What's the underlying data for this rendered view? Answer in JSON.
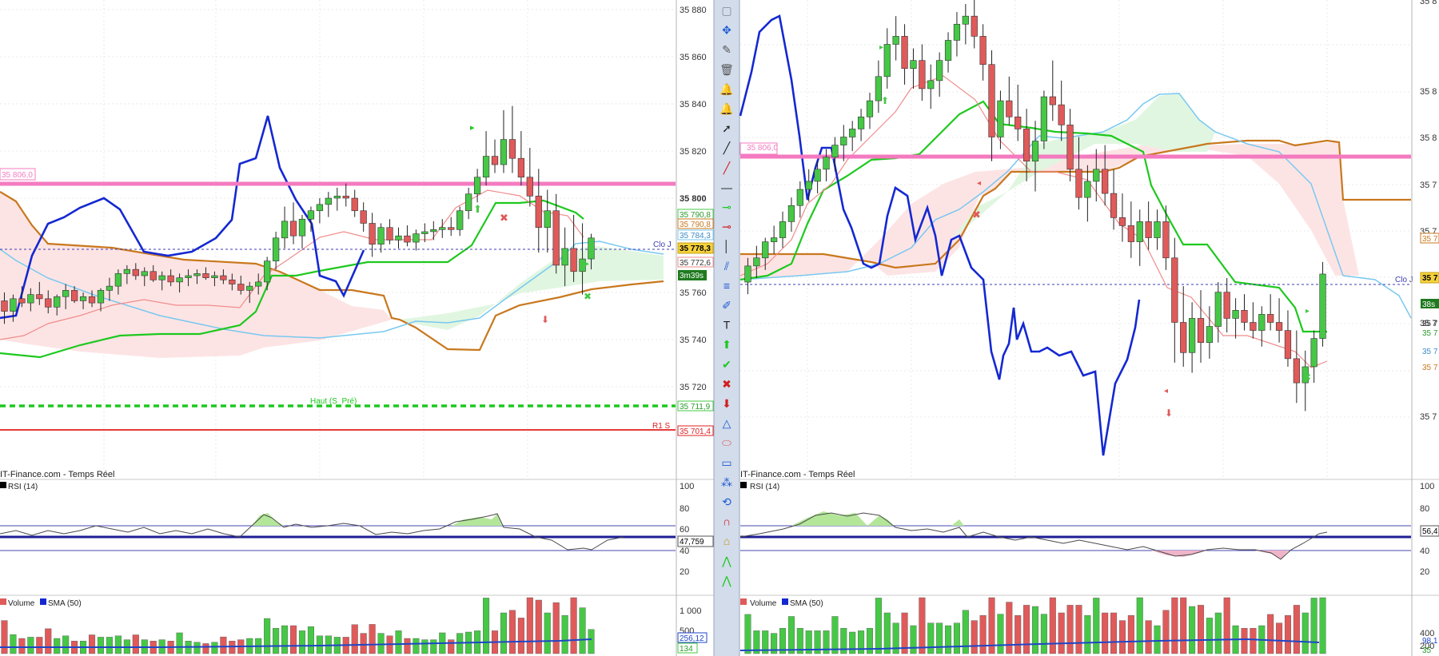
{
  "colors": {
    "bull": "#46c846",
    "bear": "#e05a5a",
    "blue": "#1428d2",
    "kijun": "#1ec81e",
    "tenkan": "#f08c8c",
    "ssb": "#c8781e",
    "ssa": "#78c8f0",
    "pink": "#f47ac0",
    "rsi_mid": "#1e1ea0",
    "sma": "#1e46c8"
  },
  "left": {
    "footer": "IT-Finance.com - Temps Réel",
    "rsi_label": "RSI (14)",
    "volume_label": "Volume",
    "sma_label": "SMA (50)",
    "price_ticks": [
      "35 880",
      "35 860",
      "35 840",
      "35 820",
      "35 800",
      "35 760",
      "35 740",
      "35 720"
    ],
    "badges": [
      "35 790,8",
      "35 790,8",
      "35 784,3",
      "35 778,3",
      "35 772,6",
      "3m39s",
      "35 711,9",
      "35 701,4"
    ],
    "pink_tag": "35 806,0",
    "clo_label": "Clo J",
    "haut_label": "Haut (S_Pré)",
    "r1_label": "R1 S",
    "rsi_ticks": [
      "100",
      "80",
      "60",
      "40",
      "20"
    ],
    "rsi_value": "47,759",
    "vol_ticks": [
      "1 000",
      "500"
    ],
    "vol_badges": [
      "256,12",
      "134"
    ]
  },
  "right": {
    "footer": "IT-Finance.com - Temps Réel",
    "rsi_label": "RSI (14)",
    "volume_label": "Volume",
    "sma_label": "SMA (50)",
    "price_ticks": [
      "35 8",
      "35 8",
      "35 8",
      "35 7",
      "35 7",
      "35 7",
      "35 7"
    ],
    "badges": [
      "35 7",
      "35 7",
      "38s",
      "35 7",
      "35 7",
      "35 7",
      "35 7"
    ],
    "pink_tag": "35 806,0",
    "clo_label": "Clo J",
    "rsi_ticks": [
      "100",
      "80",
      "60",
      "40",
      "20"
    ],
    "rsi_value": "56,4",
    "vol_ticks": [
      "400",
      "200"
    ],
    "vol_badges": [
      "98,1",
      "35"
    ]
  },
  "chart_data": [
    {
      "type": "candlestick",
      "panel": "left",
      "ylim": [
        35704,
        35884
      ],
      "ohlc": [
        [
          35745,
          35749,
          35734,
          35740
        ],
        [
          35740,
          35748,
          35735,
          35746
        ],
        [
          35746,
          35752,
          35742,
          35744
        ],
        [
          35744,
          35751,
          35740,
          35748
        ],
        [
          35748,
          35754,
          35743,
          35746
        ],
        [
          35746,
          35750,
          35739,
          35742
        ],
        [
          35742,
          35748,
          35738,
          35747
        ],
        [
          35747,
          35753,
          35741,
          35750
        ],
        [
          35750,
          35752,
          35744,
          35745
        ],
        [
          35745,
          35749,
          35741,
          35747
        ],
        [
          35747,
          35750,
          35742,
          35744
        ],
        [
          35744,
          35751,
          35740,
          35750
        ],
        [
          35750,
          35756,
          35745,
          35752
        ],
        [
          35752,
          35760,
          35748,
          35758
        ],
        [
          35758,
          35762,
          35753,
          35760
        ],
        [
          35760,
          35763,
          35755,
          35757
        ],
        [
          35757,
          35761,
          35752,
          35759
        ],
        [
          35759,
          35762,
          35754,
          35755
        ],
        [
          35755,
          35759,
          35750,
          35757
        ],
        [
          35757,
          35760,
          35752,
          35754
        ],
        [
          35754,
          35758,
          35749,
          35756
        ],
        [
          35756,
          35760,
          35752,
          35757
        ],
        [
          35757,
          35760,
          35753,
          35758
        ],
        [
          35758,
          35761,
          35755,
          35756
        ],
        [
          35756,
          35759,
          35752,
          35757
        ],
        [
          35757,
          35760,
          35753,
          35755
        ],
        [
          35755,
          35758,
          35750,
          35753
        ],
        [
          35753,
          35757,
          35748,
          35750
        ],
        [
          35750,
          35754,
          35744,
          35752
        ],
        [
          35752,
          35758,
          35748,
          35754
        ],
        [
          35754,
          35766,
          35750,
          35764
        ],
        [
          35764,
          35778,
          35760,
          35775
        ],
        [
          35775,
          35790,
          35770,
          35783
        ],
        [
          35783,
          35792,
          35772,
          35776
        ],
        [
          35776,
          35786,
          35770,
          35784
        ],
        [
          35784,
          35790,
          35778,
          35788
        ],
        [
          35788,
          35794,
          35782,
          35791
        ],
        [
          35791,
          35797,
          35785,
          35794
        ],
        [
          35794,
          35799,
          35788,
          35795
        ],
        [
          35795,
          35801,
          35790,
          35794
        ],
        [
          35794,
          35798,
          35785,
          35788
        ],
        [
          35788,
          35792,
          35778,
          35782
        ],
        [
          35782,
          35787,
          35766,
          35772
        ],
        [
          35772,
          35782,
          35768,
          35780
        ],
        [
          35780,
          35784,
          35772,
          35774
        ],
        [
          35774,
          35780,
          35770,
          35776
        ],
        [
          35776,
          35781,
          35771,
          35773
        ],
        [
          35773,
          35779,
          35769,
          35777
        ],
        [
          35777,
          35782,
          35773,
          35778
        ],
        [
          35778,
          35783,
          35774,
          35779
        ],
        [
          35779,
          35784,
          35775,
          35780
        ],
        [
          35780,
          35785,
          35776,
          35779
        ],
        [
          35779,
          35790,
          35776,
          35788
        ],
        [
          35788,
          35799,
          35784,
          35796
        ],
        [
          35796,
          35808,
          35792,
          35804
        ],
        [
          35804,
          35826,
          35800,
          35814
        ],
        [
          35814,
          35822,
          35806,
          35810
        ],
        [
          35810,
          35836,
          35806,
          35822
        ],
        [
          35822,
          35838,
          35806,
          35813
        ],
        [
          35813,
          35826,
          35800,
          35804
        ],
        [
          35804,
          35818,
          35790,
          35795
        ],
        [
          35795,
          35808,
          35768,
          35780
        ],
        [
          35780,
          35798,
          35768,
          35788
        ],
        [
          35788,
          35796,
          35758,
          35762
        ],
        [
          35762,
          35780,
          35752,
          35770
        ],
        [
          35770,
          35786,
          35754,
          35759
        ],
        [
          35759,
          35782,
          35748,
          35765
        ],
        [
          35765,
          35777,
          35760,
          35775
        ]
      ]
    },
    {
      "type": "candlestick",
      "panel": "right",
      "ylim": [
        35650,
        35880
      ],
      "ohlc": [
        [
          35740,
          35752,
          35734,
          35748
        ],
        [
          35748,
          35758,
          35742,
          35752
        ],
        [
          35752,
          35762,
          35746,
          35760
        ],
        [
          35760,
          35768,
          35754,
          35762
        ],
        [
          35762,
          35775,
          35757,
          35770
        ],
        [
          35770,
          35782,
          35765,
          35778
        ],
        [
          35778,
          35790,
          35772,
          35786
        ],
        [
          35786,
          35796,
          35780,
          35790
        ],
        [
          35790,
          35800,
          35784,
          35796
        ],
        [
          35796,
          35806,
          35790,
          35802
        ],
        [
          35802,
          35812,
          35795,
          35808
        ],
        [
          35808,
          35818,
          35800,
          35812
        ],
        [
          35812,
          35820,
          35805,
          35816
        ],
        [
          35816,
          35826,
          35810,
          35822
        ],
        [
          35822,
          35834,
          35816,
          35830
        ],
        [
          35830,
          35850,
          35824,
          35842
        ],
        [
          35842,
          35866,
          35836,
          35858
        ],
        [
          35858,
          35872,
          35850,
          35862
        ],
        [
          35862,
          35868,
          35838,
          35846
        ],
        [
          35846,
          35856,
          35836,
          35850
        ],
        [
          35850,
          35858,
          35830,
          35836
        ],
        [
          35836,
          35848,
          35826,
          35840
        ],
        [
          35840,
          35854,
          35832,
          35850
        ],
        [
          35850,
          35864,
          35844,
          35860
        ],
        [
          35860,
          35874,
          35852,
          35868
        ],
        [
          35868,
          35878,
          35858,
          35872
        ],
        [
          35872,
          35880,
          35856,
          35862
        ],
        [
          35862,
          35868,
          35840,
          35848
        ],
        [
          35848,
          35855,
          35800,
          35812
        ],
        [
          35812,
          35835,
          35806,
          35830
        ],
        [
          35830,
          35842,
          35818,
          35822
        ],
        [
          35822,
          35838,
          35810,
          35816
        ],
        [
          35816,
          35826,
          35790,
          35800
        ],
        [
          35800,
          35820,
          35785,
          35810
        ],
        [
          35810,
          35835,
          35806,
          35832
        ],
        [
          35832,
          35850,
          35820,
          35828
        ],
        [
          35828,
          35840,
          35810,
          35818
        ],
        [
          35818,
          35826,
          35790,
          35796
        ],
        [
          35796,
          35812,
          35776,
          35782
        ],
        [
          35782,
          35798,
          35770,
          35790
        ],
        [
          35790,
          35806,
          35780,
          35796
        ],
        [
          35796,
          35808,
          35778,
          35784
        ],
        [
          35784,
          35796,
          35766,
          35772
        ],
        [
          35772,
          35784,
          35760,
          35768
        ],
        [
          35768,
          35780,
          35752,
          35760
        ],
        [
          35760,
          35776,
          35748,
          35770
        ],
        [
          35770,
          35780,
          35756,
          35762
        ],
        [
          35762,
          35776,
          35756,
          35770
        ],
        [
          35770,
          35778,
          35746,
          35752
        ],
        [
          35752,
          35762,
          35700,
          35720
        ],
        [
          35720,
          35738,
          35698,
          35705
        ],
        [
          35705,
          35730,
          35695,
          35722
        ],
        [
          35722,
          35736,
          35700,
          35710
        ],
        [
          35710,
          35728,
          35702,
          35718
        ],
        [
          35718,
          35740,
          35710,
          35735
        ],
        [
          35735,
          35742,
          35715,
          35722
        ],
        [
          35722,
          35732,
          35712,
          35726
        ],
        [
          35726,
          35734,
          35716,
          35720
        ],
        [
          35720,
          35730,
          35712,
          35716
        ],
        [
          35716,
          35728,
          35708,
          35724
        ],
        [
          35724,
          35734,
          35716,
          35720
        ],
        [
          35720,
          35732,
          35710,
          35716
        ],
        [
          35716,
          35726,
          35698,
          35702
        ],
        [
          35702,
          35716,
          35680,
          35690
        ],
        [
          35690,
          35706,
          35676,
          35698
        ],
        [
          35698,
          35716,
          35690,
          35712
        ],
        [
          35712,
          35750,
          35708,
          35744
        ]
      ]
    }
  ]
}
